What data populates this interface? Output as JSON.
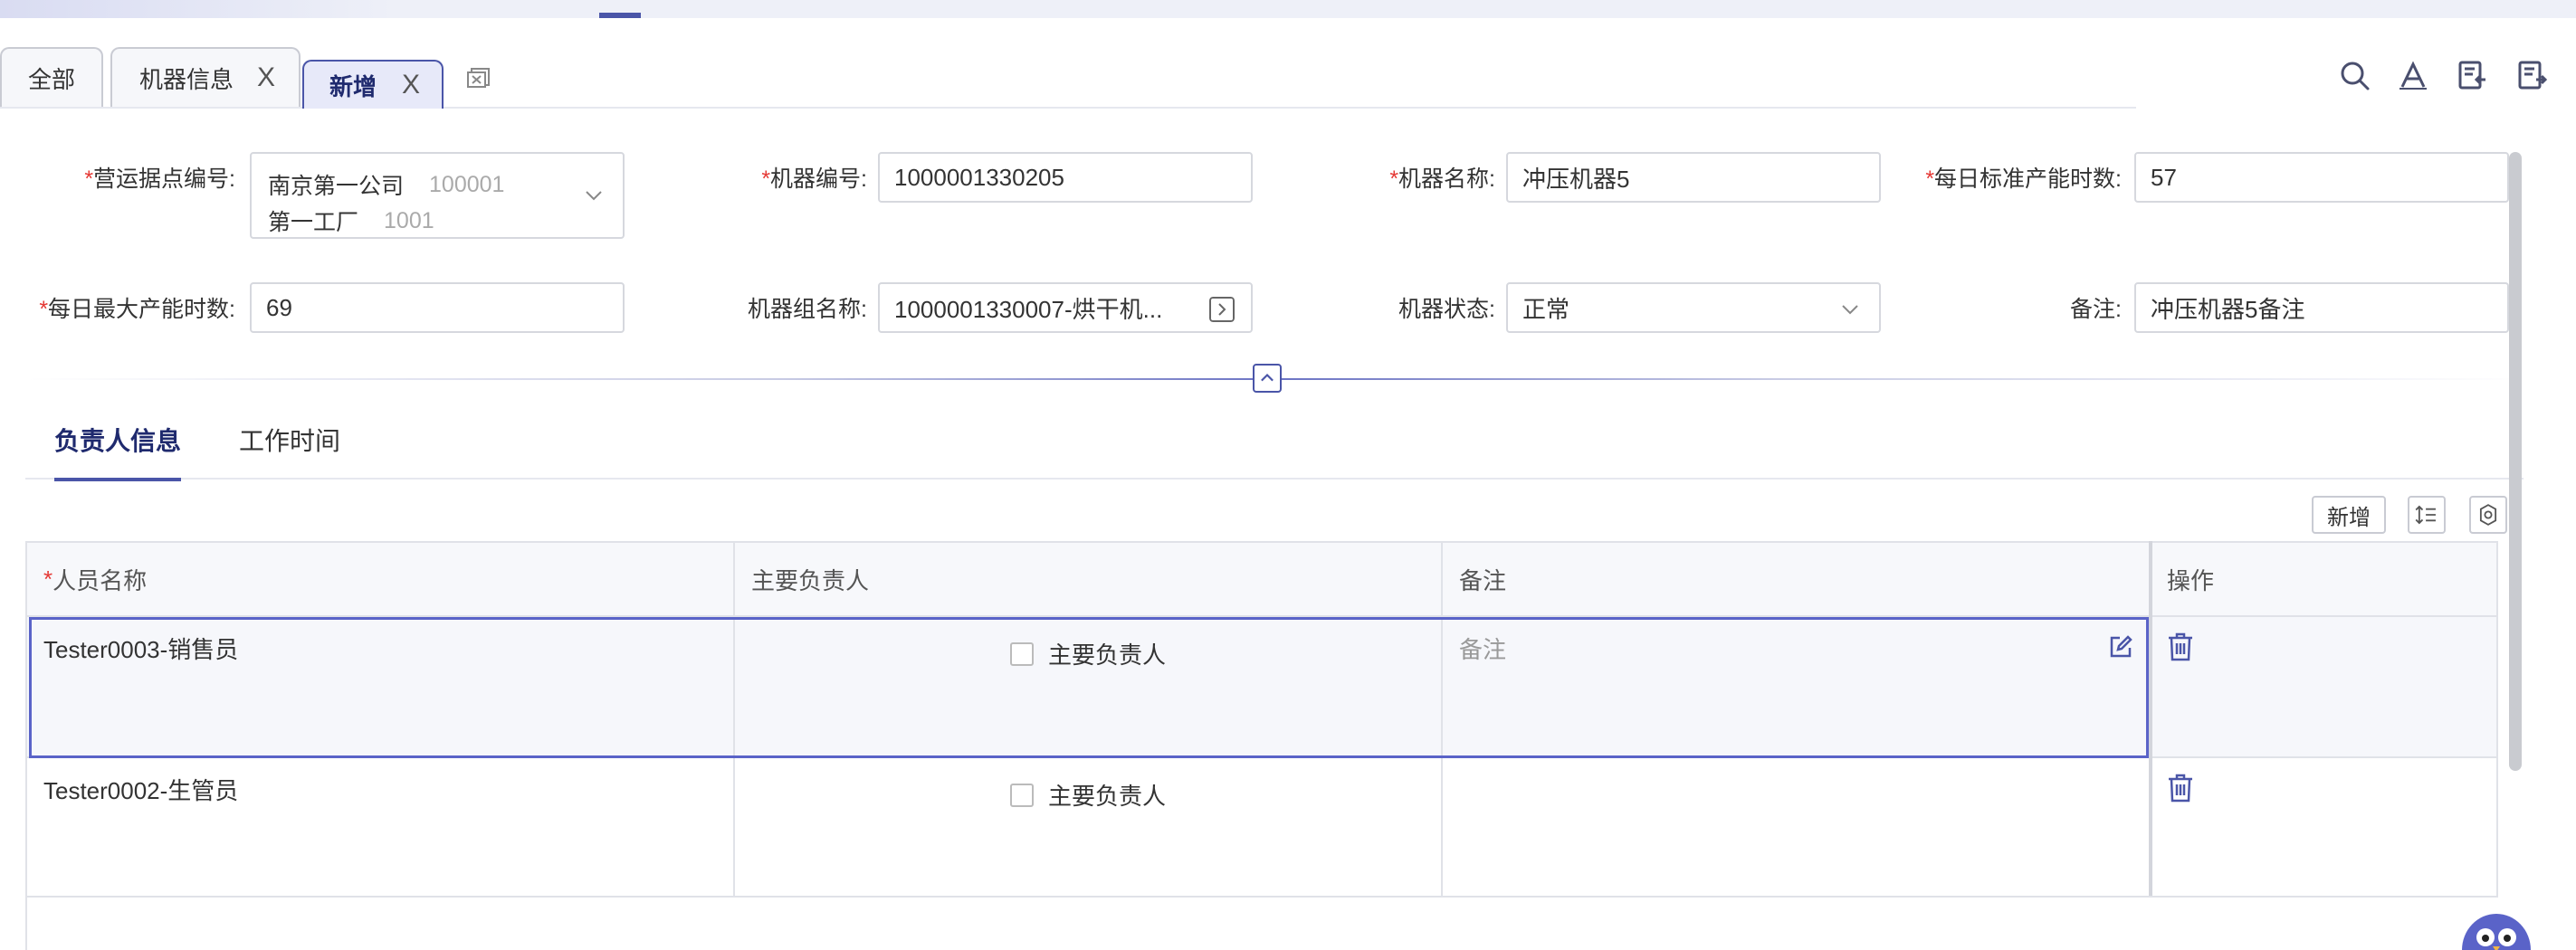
{
  "tabs": [
    {
      "label": "全部"
    },
    {
      "label": "机器信息",
      "close": "X"
    },
    {
      "label": "新增",
      "close": "X",
      "active": true
    }
  ],
  "toolbar": {
    "icons": [
      "search-icon",
      "font-icon",
      "import-icon",
      "export-icon"
    ]
  },
  "form": {
    "site_label": "营运据点编号:",
    "site_line1_name": "南京第一公司",
    "site_line1_code": "100001",
    "site_line2_name": "第一工厂",
    "site_line2_code": "1001",
    "machine_no_label": "机器编号:",
    "machine_no_value": "1000001330205",
    "machine_name_label": "机器名称:",
    "machine_name_value": "冲压机器5",
    "daily_std_label": "每日标准产能时数:",
    "daily_std_value": "57",
    "daily_max_label": "每日最大产能时数:",
    "daily_max_value": "69",
    "group_label": "机器组名称:",
    "group_value": "1000001330007-烘干机...",
    "status_label": "机器状态:",
    "status_value": "正常",
    "remark_label": "备注:",
    "remark_value": "冲压机器5备注",
    "required_mark": "*"
  },
  "subtabs": [
    {
      "label": "负责人信息",
      "active": true
    },
    {
      "label": "工作时间"
    }
  ],
  "grid": {
    "add_label": "新增",
    "columns": [
      "人员名称",
      "主要负责人",
      "备注",
      "操作"
    ],
    "rows": [
      {
        "person": "Tester0003-销售员",
        "primary_label": "主要负责人",
        "remark_placeholder": "备注"
      },
      {
        "person": "Tester0002-生管员",
        "primary_label": "主要负责人",
        "remark": ""
      }
    ]
  },
  "colors": {
    "accent": "#4a55a8",
    "required": "#e53935",
    "tab_active_bg": "#e7e9f9"
  }
}
